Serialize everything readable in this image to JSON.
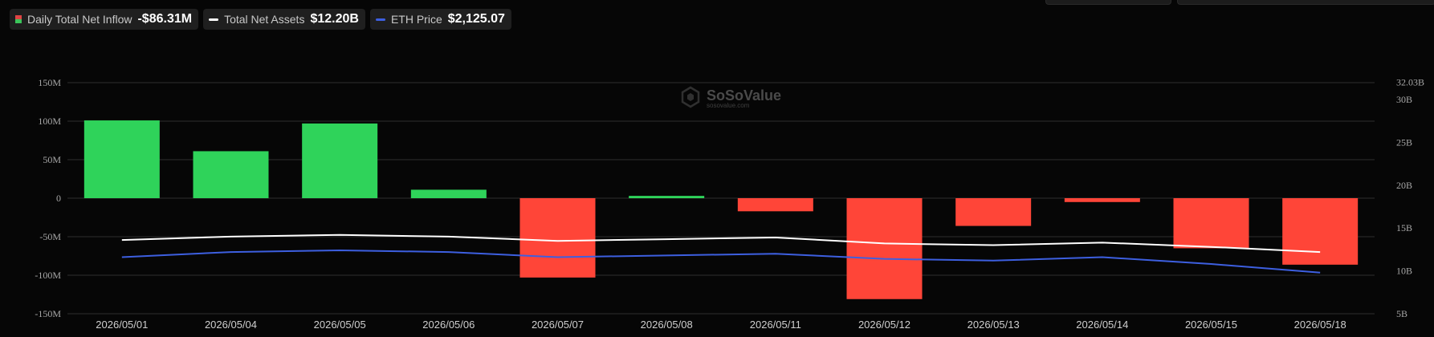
{
  "legend": [
    {
      "label": "Daily Total Net Inflow",
      "value": "-$86.31M",
      "swatch": "split",
      "colors": [
        "#e04444",
        "#3cc45a"
      ]
    },
    {
      "label": "Total Net Assets",
      "value": "$12.20B",
      "swatch": "line",
      "colors": [
        "#ffffff"
      ]
    },
    {
      "label": "ETH Price",
      "value": "$2,125.07",
      "swatch": "line",
      "colors": [
        "#3d5fe0"
      ]
    }
  ],
  "watermark": {
    "brand": "SoSoValue",
    "sub": "sosovalue.com"
  },
  "chart_data": {
    "type": "bar",
    "categories": [
      "2026/05/01",
      "2026/05/04",
      "2026/05/05",
      "2026/05/06",
      "2026/05/07",
      "2026/05/08",
      "2026/05/11",
      "2026/05/12",
      "2026/05/13",
      "2026/05/14",
      "2026/05/15",
      "2026/05/18"
    ],
    "series": [
      {
        "name": "Daily Total Net Inflow",
        "type": "bar",
        "axis": "left",
        "values": [
          101,
          61,
          97,
          11,
          -103,
          3,
          -17,
          -131,
          -36,
          -5,
          -65,
          -86.31
        ]
      },
      {
        "name": "Total Net Assets",
        "type": "line",
        "axis": "right",
        "values": [
          13.6,
          14.0,
          14.2,
          14.0,
          13.5,
          13.7,
          13.9,
          13.2,
          13.0,
          13.3,
          12.8,
          12.2
        ]
      },
      {
        "name": "ETH Price",
        "type": "line",
        "axis": "right",
        "values": [
          11.6,
          12.2,
          12.4,
          12.2,
          11.6,
          11.8,
          12.0,
          11.4,
          11.2,
          11.6,
          10.8,
          9.8
        ]
      }
    ],
    "left_axis": {
      "ticks": [
        150,
        100,
        50,
        0,
        -50,
        -100,
        -150
      ],
      "tick_labels": [
        "150M",
        "100M",
        "50M",
        "0",
        "-50M",
        "-100M",
        "-150M"
      ],
      "ylim": [
        -150,
        150
      ]
    },
    "right_axis": {
      "ticks": [
        32.03,
        30,
        25,
        20,
        15,
        10,
        5
      ],
      "tick_labels": [
        "32.03B",
        "30B",
        "25B",
        "20B",
        "15B",
        "10B",
        "5B"
      ],
      "ylim": [
        5,
        32.03
      ]
    },
    "colors": {
      "positive": "#2fd35a",
      "negative": "#ff4538",
      "assets_line": "#ffffff",
      "price_line": "#3d5fe0",
      "grid": "#2e2e2e"
    },
    "grid": true
  }
}
